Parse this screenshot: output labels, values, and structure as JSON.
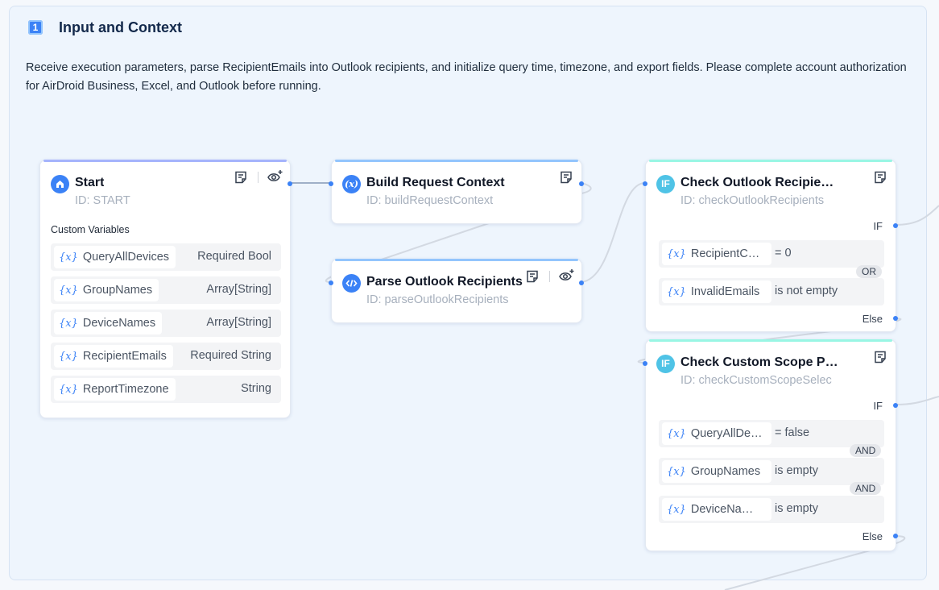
{
  "group": {
    "number": "1",
    "title": "Input and Context",
    "description": "Receive execution parameters, parse RecipientEmails into Outlook recipients, and initialize query time, timezone, and export fields. Please complete account authorization for AirDroid Business, Excel, and Outlook before running."
  },
  "colors": {
    "accent": "#3b82f6",
    "start_bar": "#a5b4fc",
    "code_bar": "#93c5fd",
    "if_bar": "#99f6e4",
    "if_icon": "#4fc3e6"
  },
  "start_node": {
    "title": "Start",
    "id_text": "ID: START",
    "icon": "home-icon",
    "section_label": "Custom Variables",
    "variables": [
      {
        "name": "QueryAllDevices",
        "type": "Required Bool"
      },
      {
        "name": "GroupNames",
        "type": "Array[String]"
      },
      {
        "name": "DeviceNames",
        "type": "Array[String]"
      },
      {
        "name": "RecipientEmails",
        "type": "Required String"
      },
      {
        "name": "ReportTimezone",
        "type": "String"
      }
    ]
  },
  "build_node": {
    "title": "Build Request Context",
    "id_text": "ID: buildRequestContext",
    "icon": "variable-icon"
  },
  "parse_node": {
    "title": "Parse Outlook Recipients",
    "id_text": "ID: parseOutlookRecipients",
    "icon": "code-icon"
  },
  "check_recipients_node": {
    "title": "Check Outlook Recipients",
    "title_display": "Check Outlook Recipie…",
    "id_text": "ID: checkOutlookRecipients",
    "icon": "if-icon",
    "icon_text": "IF",
    "if_label": "IF",
    "else_label": "Else",
    "conditions": [
      {
        "name": "RecipientC…",
        "op": "= 0"
      },
      {
        "name": "InvalidEmails",
        "op": "is not empty"
      }
    ],
    "logic": [
      "OR"
    ]
  },
  "check_scope_node": {
    "title_display": "Check Custom Scope P…",
    "id_text": "ID: checkCustomScopeSelec",
    "icon": "if-icon",
    "icon_text": "IF",
    "if_label": "IF",
    "else_label": "Else",
    "conditions": [
      {
        "name": "QueryAllDe…",
        "op": "= false"
      },
      {
        "name": "GroupNames",
        "op": "is empty"
      },
      {
        "name": "DeviceNa…",
        "op": "is empty"
      }
    ],
    "logic": [
      "AND",
      "AND"
    ]
  },
  "var_glyph": "{x}"
}
